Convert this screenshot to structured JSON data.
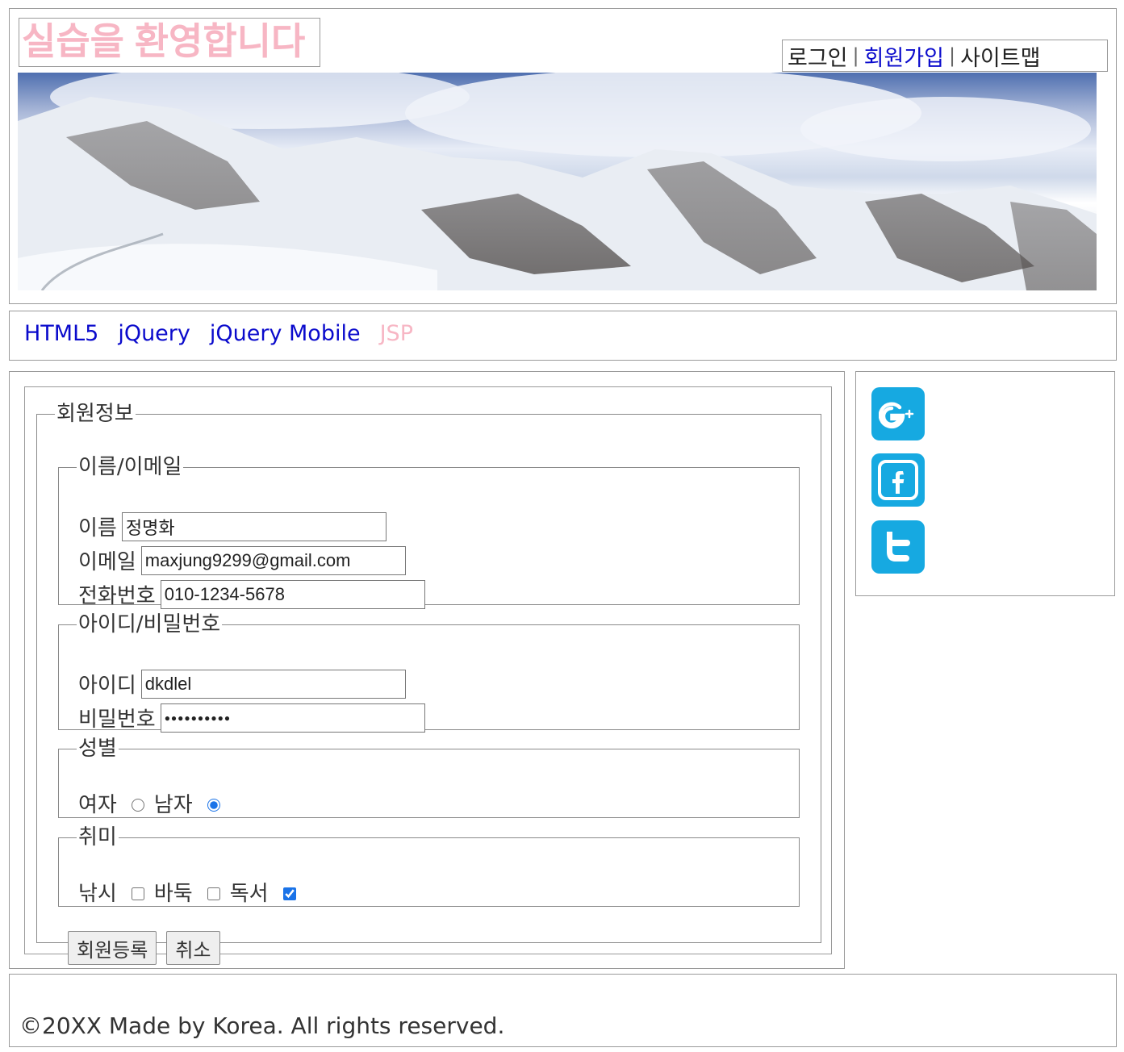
{
  "header": {
    "site_title": "실습을 환영합니다",
    "util_nav": {
      "items": [
        {
          "label": "로그인"
        },
        {
          "label": "회원가입"
        },
        {
          "label": "사이트맵"
        }
      ],
      "separator": "|"
    },
    "banner": {
      "description_icon": "mountain-banner-image"
    }
  },
  "nav": {
    "items": [
      {
        "label": "HTML5"
      },
      {
        "label": "jQuery"
      },
      {
        "label": "jQuery Mobile"
      },
      {
        "label": "JSP"
      }
    ]
  },
  "form": {
    "legend": "회원정보",
    "name_group": {
      "legend": "이름/이메일",
      "name_label": "이름",
      "name_value": "정명화",
      "email_label": "이메일",
      "email_value": "maxjung9299@gmail.com",
      "phone_label": "전화번호",
      "phone_value": "010-1234-5678"
    },
    "id_group": {
      "legend": "아이디/비밀번호",
      "id_label": "아이디",
      "id_value": "dkdlel",
      "password_label": "비밀번호",
      "password_value": "●●●●●●●●●●"
    },
    "gender_group": {
      "legend": "성별",
      "female_label": "여자",
      "male_label": "남자",
      "selected": "남자"
    },
    "hobby_group": {
      "legend": "취미",
      "fishing_label": "낚시",
      "baduk_label": "바둑",
      "reading_label": "독서",
      "checked": [
        "독서"
      ]
    },
    "buttons": {
      "submit_label": "회원등록",
      "cancel_label": "취소"
    }
  },
  "aside": {
    "icons": [
      "google-plus-icon",
      "facebook-icon",
      "twitter-icon"
    ],
    "color": "#16a9e1"
  },
  "footer": {
    "text": "©20XX Made by Korea. All rights reserved."
  },
  "colors": {
    "title_pink": "#f7b6c4",
    "link_blue": "#0a0acc",
    "social_blue": "#16a9e1"
  }
}
